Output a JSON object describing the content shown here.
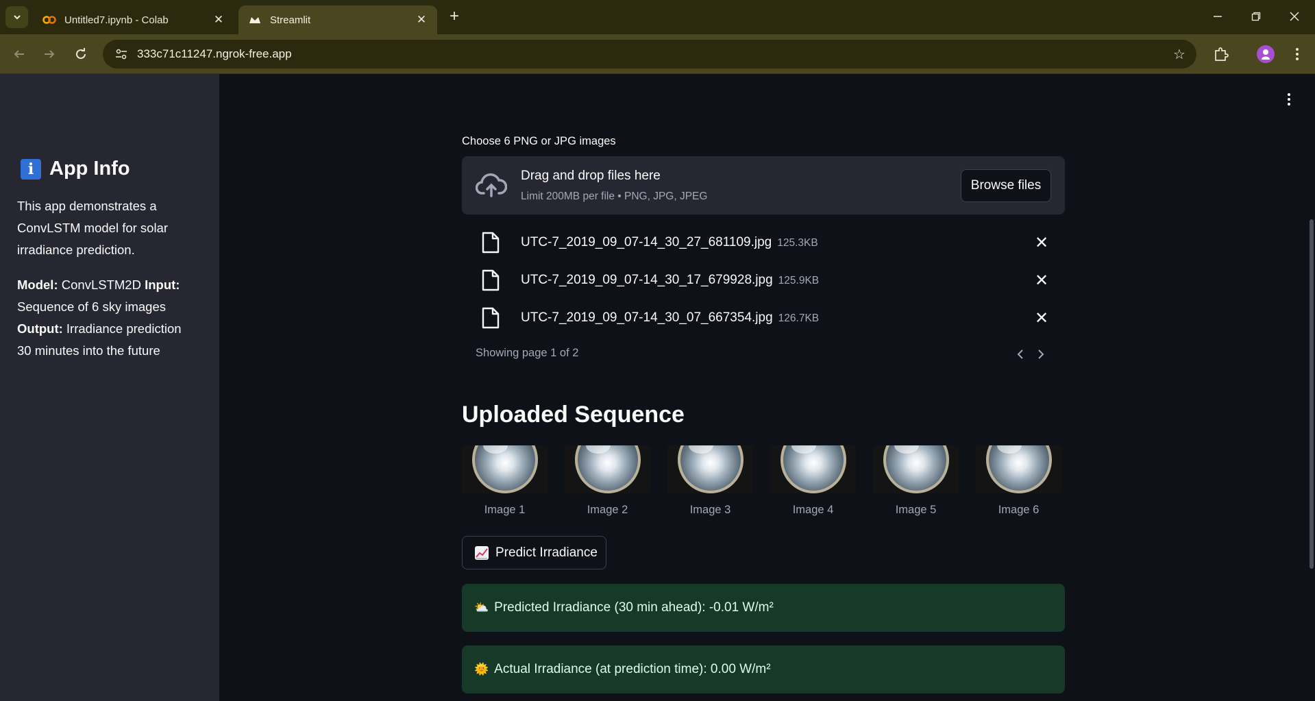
{
  "browser": {
    "tabs": [
      {
        "title": "Untitled7.ipynb - Colab",
        "active": false,
        "favicon": "colab-icon"
      },
      {
        "title": "Streamlit",
        "active": true,
        "favicon": "streamlit-icon"
      }
    ],
    "url": "333c71c11247.ngrok-free.app",
    "profile_color": "#a64fd1"
  },
  "sidebar": {
    "title": "App Info",
    "title_icon": "info-icon",
    "description": "This app demonstrates a ConvLSTM model for solar irradiance prediction.",
    "model_label": "Model:",
    "model_value": "ConvLSTM2D",
    "input_label": "Input:",
    "input_value": "Sequence of 6 sky images",
    "output_label": "Output:",
    "output_value": "Irradiance prediction 30 minutes into the future"
  },
  "uploader": {
    "label": "Choose 6 PNG or JPG images",
    "drop_text": "Drag and drop files here",
    "limit_text": "Limit 200MB per file • PNG, JPG, JPEG",
    "browse_label": "Browse files",
    "files": [
      {
        "name": "UTC-7_2019_09_07-14_30_27_681109.jpg",
        "size": "125.3KB"
      },
      {
        "name": "UTC-7_2019_09_07-14_30_17_679928.jpg",
        "size": "125.9KB"
      },
      {
        "name": "UTC-7_2019_09_07-14_30_07_667354.jpg",
        "size": "126.7KB"
      }
    ],
    "pager_text": "Showing page 1 of 2"
  },
  "sequence": {
    "title": "Uploaded Sequence",
    "images": [
      "Image 1",
      "Image 2",
      "Image 3",
      "Image 4",
      "Image 5",
      "Image 6"
    ]
  },
  "predict_button": {
    "label": "Predict Irradiance",
    "icon": "chart-increasing-icon"
  },
  "results": {
    "predicted": {
      "icon": "sun-behind-cloud-icon",
      "text": "Predicted Irradiance (30 min ahead): -0.01 W/m²"
    },
    "actual": {
      "icon": "sun-with-face-icon",
      "text": "Actual Irradiance (at prediction time): 0.00 W/m²"
    }
  },
  "colors": {
    "app_bg": "#0e1117",
    "sidebar_bg": "#262730",
    "success_bg": "#173928",
    "chrome_bg": "#2c2a0e"
  }
}
